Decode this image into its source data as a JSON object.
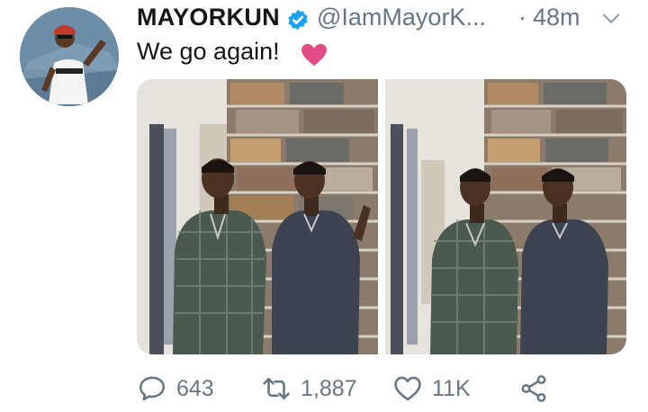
{
  "tweet": {
    "display_name": "MAYORKUN",
    "handle": "@IamMayorK...",
    "separator": "·",
    "time": "48m",
    "text": "We go again!",
    "verified": true,
    "emoji": "pink-heart"
  },
  "actions": {
    "replies": "643",
    "retweets": "1,887",
    "likes": "11K"
  },
  "colors": {
    "verified_blue": "#1da1f2",
    "secondary_text": "#657786",
    "heart_pink": "#e0245e"
  }
}
